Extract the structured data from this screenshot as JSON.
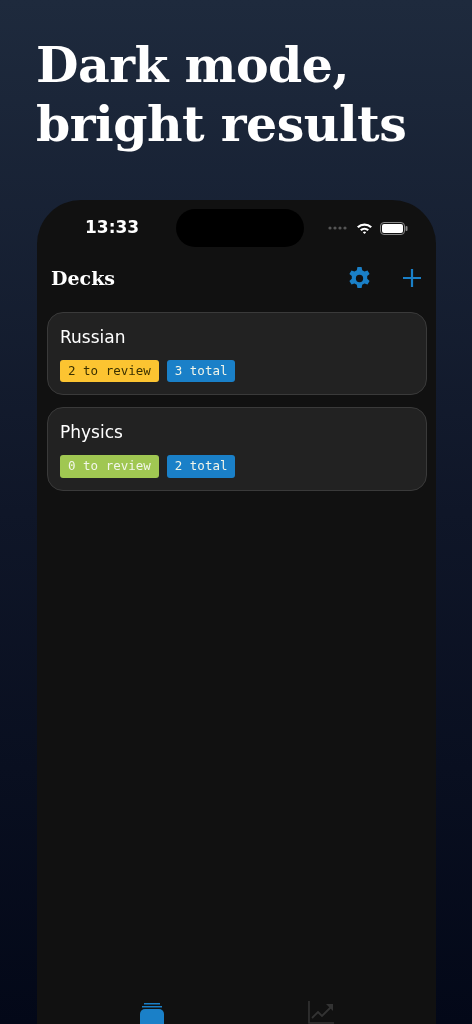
{
  "headline": "Dark mode, bright results",
  "status_bar": {
    "time": "13:33"
  },
  "nav": {
    "title": "Decks"
  },
  "decks": [
    {
      "name": "Russian",
      "badges": [
        {
          "text": "2 to review",
          "color": "#fcc431"
        },
        {
          "text": "3 total",
          "color": "#1a80c8"
        }
      ]
    },
    {
      "name": "Physics",
      "badges": [
        {
          "text": "0 to review",
          "color": "#a0c752"
        },
        {
          "text": "2 total",
          "color": "#1a80c8"
        }
      ]
    }
  ],
  "tab_bar": [
    {
      "kind": "decks",
      "selected": true
    },
    {
      "kind": "stats",
      "selected": false
    }
  ]
}
